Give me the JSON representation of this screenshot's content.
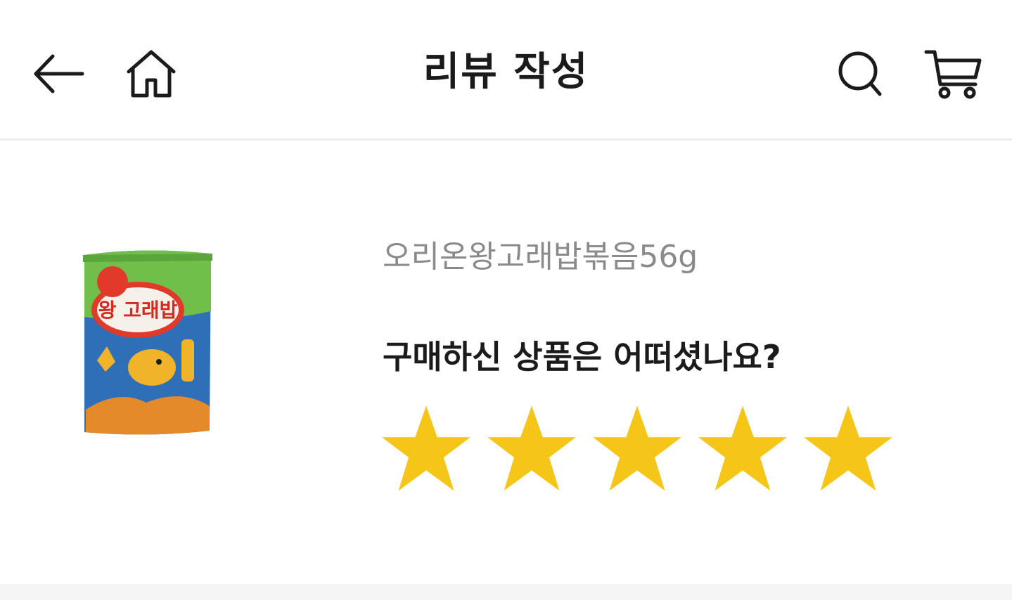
{
  "header": {
    "title": "리뷰 작성",
    "back_icon": "arrow-left-icon",
    "home_icon": "home-icon",
    "search_icon": "search-icon",
    "cart_icon": "cart-icon"
  },
  "product": {
    "name": "오리온왕고래밥볶음56g",
    "image_label": "왕 고래밥",
    "image_alt": "product-thumbnail"
  },
  "rating": {
    "question": "구매하신 상품은 어떠셨나요?",
    "max": 5,
    "value": 5,
    "star_icon": "star-icon",
    "star_color": "#f5c518"
  },
  "colors": {
    "title_text": "#1b1b1b",
    "product_name_text": "#8a8a8a",
    "divider": "#ededed",
    "star_fill": "#f5c518"
  }
}
